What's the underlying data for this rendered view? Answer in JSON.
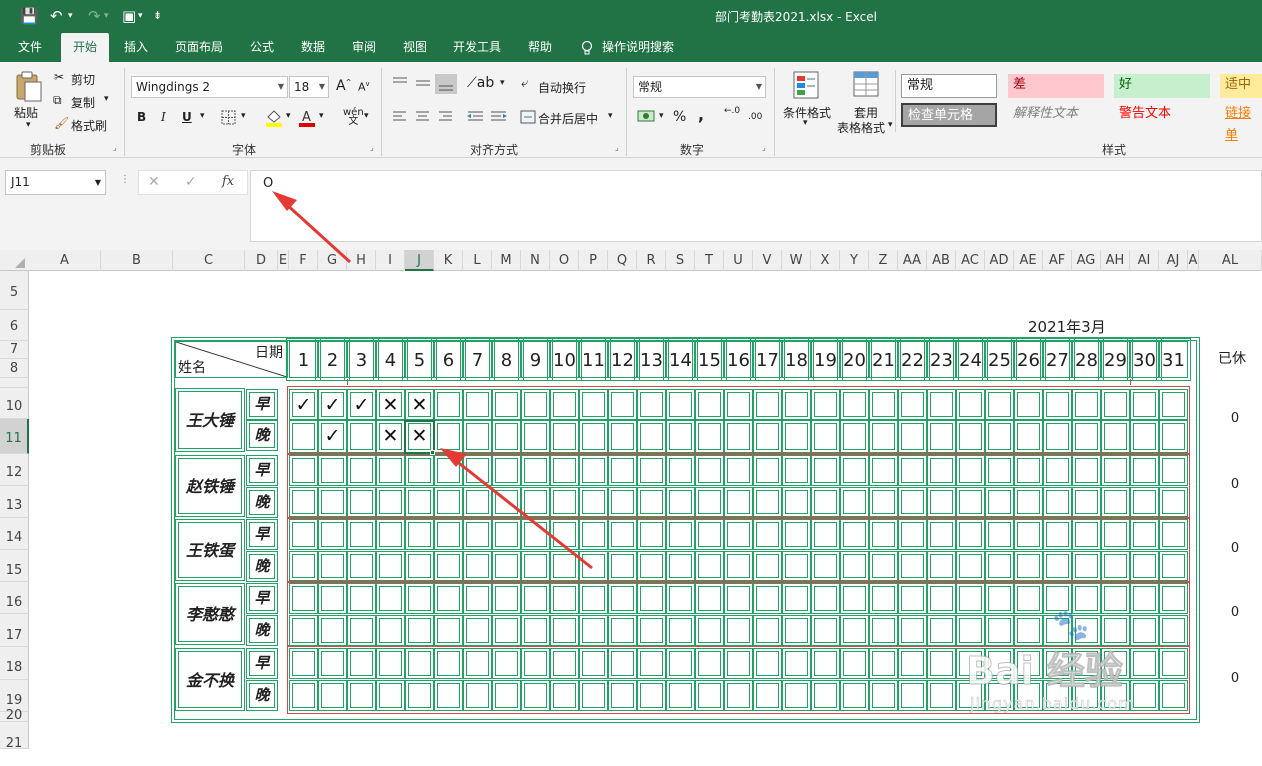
{
  "app": {
    "title": "部门考勤表2021.xlsx  -  Excel"
  },
  "qat": {
    "save": "💾",
    "undo": "↶",
    "undo_dd": "▾",
    "redo": "↷",
    "redo_dd": "▾",
    "touch": "▣",
    "touch_dd": "▾",
    "customize": "⇟"
  },
  "menu": [
    "文件",
    "开始",
    "插入",
    "页面布局",
    "公式",
    "数据",
    "审阅",
    "视图",
    "开发工具",
    "帮助",
    "操作说明搜索"
  ],
  "menu_search_icon": "lightbulb-icon",
  "ribbon": {
    "clipboard": {
      "paste": "粘贴",
      "cut": "剪切",
      "copy": "复制",
      "format_painter": "格式刷",
      "label": "剪贴板"
    },
    "font": {
      "name": "Wingdings 2",
      "size": "18",
      "grow": "A",
      "shrink": "A",
      "bold": "B",
      "italic": "I",
      "underline": "U",
      "label": "字体"
    },
    "align": {
      "wrap": "自动换行",
      "merge": "合并后居中",
      "label": "对齐方式"
    },
    "number": {
      "format": "常规",
      "percent": "%",
      "comma": ",",
      "inc": "←.0",
      "dec": ".00",
      "label": "数字"
    },
    "styles": {
      "cond": "条件格式",
      "table_l1": "套用",
      "table_l2": "表格格式",
      "normal": "常规",
      "bad": "差",
      "good": "好",
      "neutral": "适中",
      "check": "检查单元格",
      "explanatory": "解释性文本",
      "warning": "警告文本",
      "link": "链接单",
      "label": "样式"
    }
  },
  "formula": {
    "namebox": "J11",
    "cancel": "✕",
    "enter": "✓",
    "fx": "fx",
    "value": "O"
  },
  "columns": [
    "A",
    "B",
    "C",
    "D",
    "E",
    "F",
    "G",
    "H",
    "I",
    "J",
    "K",
    "L",
    "M",
    "N",
    "O",
    "P",
    "Q",
    "R",
    "S",
    "T",
    "U",
    "V",
    "W",
    "X",
    "Y",
    "Z",
    "AA",
    "AB",
    "AC",
    "AD",
    "AE",
    "AF",
    "AG",
    "AH",
    "AI",
    "AJ",
    "A",
    "AL"
  ],
  "rows": [
    "5",
    "6",
    "7",
    "8",
    "",
    "10",
    "11",
    "12",
    "13",
    "14",
    "15",
    "16",
    "17",
    "18",
    "19",
    "20",
    "21"
  ],
  "sheet": {
    "month": "2021年3月",
    "header_date": "日期",
    "header_name": "姓名",
    "rest_header": "已休",
    "days": [
      "1",
      "2",
      "3",
      "4",
      "5",
      "6",
      "7",
      "8",
      "9",
      "10",
      "11",
      "12",
      "13",
      "14",
      "15",
      "16",
      "17",
      "18",
      "19",
      "20",
      "21",
      "22",
      "23",
      "24",
      "25",
      "26",
      "27",
      "28",
      "29",
      "30",
      "31"
    ],
    "am": "早",
    "pm": "晚",
    "people": [
      {
        "name": "王大锤",
        "rest": "0",
        "am": [
          "✓",
          "✓",
          "✓",
          "✕",
          "✕"
        ],
        "pm": [
          "",
          "✓",
          "",
          "✕",
          "✕"
        ]
      },
      {
        "name": "赵铁锤",
        "rest": "0",
        "am": [],
        "pm": []
      },
      {
        "name": "王铁蛋",
        "rest": "0",
        "am": [],
        "pm": []
      },
      {
        "name": "李憨憨",
        "rest": "0",
        "am": [],
        "pm": []
      },
      {
        "name": "金不换",
        "rest": "0",
        "am": [],
        "pm": []
      }
    ]
  },
  "watermark": {
    "brand": "Bai 经验",
    "url": "jingyan.baidu.com"
  },
  "colors": {
    "excel_green": "#217346",
    "cell_green": "#21a366",
    "block_red": "#d24a4a",
    "arrow": "#e53935"
  }
}
